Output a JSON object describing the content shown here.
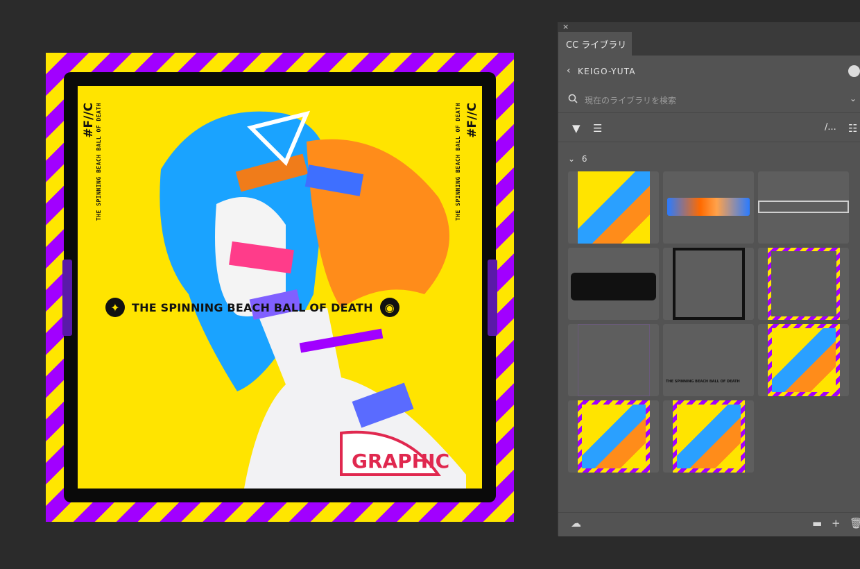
{
  "artwork": {
    "title": "THE SPINNING BEACH BALL OF DEATH",
    "corner_title": "#F//C",
    "corner_subtitle": "THE SPINNING BEACH BALL OF DEATH",
    "colors": {
      "yellow": "#ffe400",
      "purple": "#a100ff",
      "frame": "#0a0a0a"
    }
  },
  "panel": {
    "close_label": "×",
    "tab_label": "CC ライブラリ",
    "library_name": "KEIGO-YUTA",
    "search": {
      "placeholder": "現在のライブラリを検索"
    },
    "toolbar": {
      "filter_icon": "filter-icon",
      "sort_icon": "sort-icon",
      "view_icon": "list-view-icon",
      "more_label": "/..."
    },
    "group": {
      "toggle": "⌄",
      "count": "6"
    },
    "assets": [
      {
        "kind": "artwork-thumbnail"
      },
      {
        "kind": "graffiti-logo-color"
      },
      {
        "kind": "export-logo"
      },
      {
        "kind": "graffiti-logo-black"
      },
      {
        "kind": "black-frame"
      },
      {
        "kind": "striped-frame"
      },
      {
        "kind": "empty-frame"
      },
      {
        "kind": "title-strip",
        "text": "THE SPINNING BEACH BALL OF DEATH"
      },
      {
        "kind": "full-composite-1"
      },
      {
        "kind": "full-composite-2"
      },
      {
        "kind": "full-composite-3"
      }
    ],
    "footer": {
      "cloud_icon": "cloud-icon",
      "folder_icon": "folder-icon",
      "add_icon": "add-icon",
      "trash_icon": "trash-icon"
    }
  }
}
